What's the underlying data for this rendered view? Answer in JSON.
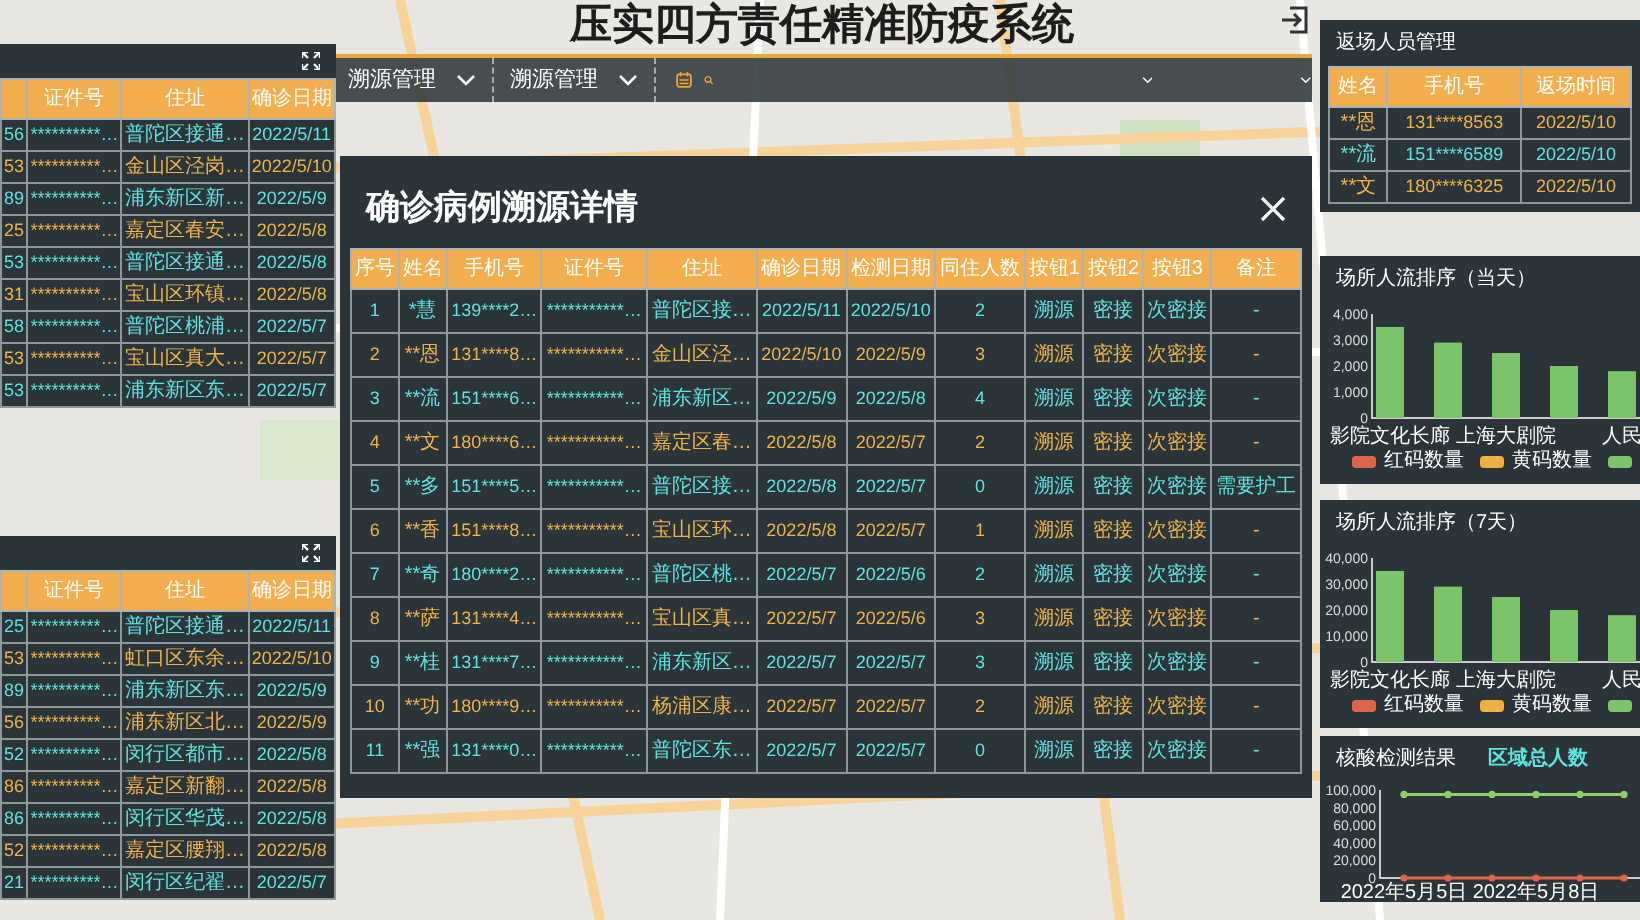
{
  "header": {
    "title": "压实四方责任精准防疫系统",
    "menus": [
      {
        "label": "溯源管理"
      },
      {
        "label": "溯源管理"
      }
    ]
  },
  "left_panels": [
    {
      "columns": [
        "",
        "证件号",
        "住址",
        "确诊日期"
      ],
      "rows": [
        {
          "cells": [
            "56",
            "**********…",
            "普陀区接通…",
            "2022/5/11"
          ],
          "color": "#5fe3e0"
        },
        {
          "cells": [
            "53",
            "**********…",
            "金山区泾岗…",
            "2022/5/10"
          ],
          "color": "#f0b24a"
        },
        {
          "cells": [
            "89",
            "**********…",
            "浦东新区新…",
            "2022/5/9"
          ],
          "color": "#5fe3e0"
        },
        {
          "cells": [
            "25",
            "**********…",
            "嘉定区春安…",
            "2022/5/8"
          ],
          "color": "#f0b24a"
        },
        {
          "cells": [
            "53",
            "**********…",
            "普陀区接通…",
            "2022/5/8"
          ],
          "color": "#5fe3e0"
        },
        {
          "cells": [
            "31",
            "**********…",
            "宝山区环镇…",
            "2022/5/8"
          ],
          "color": "#f0b24a"
        },
        {
          "cells": [
            "58",
            "**********…",
            "普陀区桃浦…",
            "2022/5/7"
          ],
          "color": "#5fe3e0"
        },
        {
          "cells": [
            "53",
            "**********…",
            "宝山区真大…",
            "2022/5/7"
          ],
          "color": "#f0b24a"
        },
        {
          "cells": [
            "53",
            "**********…",
            "浦东新区东…",
            "2022/5/7"
          ],
          "color": "#5fe3e0"
        }
      ]
    },
    {
      "columns": [
        "",
        "证件号",
        "住址",
        "确诊日期"
      ],
      "rows": [
        {
          "cells": [
            "25",
            "**********…",
            "普陀区接通…",
            "2022/5/11"
          ],
          "color": "#5fe3e0"
        },
        {
          "cells": [
            "53",
            "**********…",
            "虹口区东余…",
            "2022/5/10"
          ],
          "color": "#f0b24a"
        },
        {
          "cells": [
            "89",
            "**********…",
            "浦东新区东…",
            "2022/5/9"
          ],
          "color": "#5fe3e0"
        },
        {
          "cells": [
            "56",
            "**********…",
            "浦东新区北…",
            "2022/5/9"
          ],
          "color": "#f0b24a"
        },
        {
          "cells": [
            "52",
            "**********…",
            "闵行区都市…",
            "2022/5/8"
          ],
          "color": "#5fe3e0"
        },
        {
          "cells": [
            "86",
            "**********…",
            "嘉定区新翻…",
            "2022/5/8"
          ],
          "color": "#f0b24a"
        },
        {
          "cells": [
            "86",
            "**********…",
            "闵行区华茂…",
            "2022/5/8"
          ],
          "color": "#5fe3e0"
        },
        {
          "cells": [
            "52",
            "**********…",
            "嘉定区腰翔…",
            "2022/5/8"
          ],
          "color": "#f0b24a"
        },
        {
          "cells": [
            "21",
            "**********…",
            "闵行区纪翟…",
            "2022/5/7"
          ],
          "color": "#5fe3e0"
        }
      ]
    }
  ],
  "modal": {
    "title": "确诊病例溯源详情",
    "columns": [
      "序号",
      "姓名",
      "手机号",
      "证件号",
      "住址",
      "确诊日期",
      "检测日期",
      "同住人数",
      "按钮1",
      "按钮2",
      "按钮3",
      "备注"
    ],
    "rows": [
      {
        "cells": [
          "1",
          "*慧",
          "139****2…",
          "***********…",
          "普陀区接…",
          "2022/5/11",
          "2022/5/10",
          "2",
          "溯源",
          "密接",
          "次密接",
          "-"
        ],
        "color": "#5fe3e0"
      },
      {
        "cells": [
          "2",
          "**恩",
          "131****8…",
          "***********…",
          "金山区泾…",
          "2022/5/10",
          "2022/5/9",
          "3",
          "溯源",
          "密接",
          "次密接",
          "-"
        ],
        "color": "#f0b24a"
      },
      {
        "cells": [
          "3",
          "**流",
          "151****6…",
          "***********…",
          "浦东新区…",
          "2022/5/9",
          "2022/5/8",
          "4",
          "溯源",
          "密接",
          "次密接",
          "-"
        ],
        "color": "#5fe3e0"
      },
      {
        "cells": [
          "4",
          "**文",
          "180****6…",
          "***********…",
          "嘉定区春…",
          "2022/5/8",
          "2022/5/7",
          "2",
          "溯源",
          "密接",
          "次密接",
          "-"
        ],
        "color": "#f0b24a"
      },
      {
        "cells": [
          "5",
          "**多",
          "151****5…",
          "***********…",
          "普陀区接…",
          "2022/5/8",
          "2022/5/7",
          "0",
          "溯源",
          "密接",
          "次密接",
          "需要护工"
        ],
        "color": "#5fe3e0"
      },
      {
        "cells": [
          "6",
          "**香",
          "151****8…",
          "***********…",
          "宝山区环…",
          "2022/5/8",
          "2022/5/7",
          "1",
          "溯源",
          "密接",
          "次密接",
          "-"
        ],
        "color": "#f0b24a"
      },
      {
        "cells": [
          "7",
          "**奇",
          "180****2…",
          "***********…",
          "普陀区桃…",
          "2022/5/7",
          "2022/5/6",
          "2",
          "溯源",
          "密接",
          "次密接",
          "-"
        ],
        "color": "#5fe3e0"
      },
      {
        "cells": [
          "8",
          "**萨",
          "131****4…",
          "***********…",
          "宝山区真…",
          "2022/5/7",
          "2022/5/6",
          "3",
          "溯源",
          "密接",
          "次密接",
          "-"
        ],
        "color": "#f0b24a"
      },
      {
        "cells": [
          "9",
          "**桂",
          "131****7…",
          "***********…",
          "浦东新区…",
          "2022/5/7",
          "2022/5/7",
          "3",
          "溯源",
          "密接",
          "次密接",
          "-"
        ],
        "color": "#5fe3e0"
      },
      {
        "cells": [
          "10",
          "**功",
          "180****9…",
          "***********…",
          "杨浦区康…",
          "2022/5/7",
          "2022/5/7",
          "2",
          "溯源",
          "密接",
          "次密接",
          "-"
        ],
        "color": "#f0b24a"
      },
      {
        "cells": [
          "11",
          "**强",
          "131****0…",
          "***********…",
          "普陀区东…",
          "2022/5/7",
          "2022/5/7",
          "0",
          "溯源",
          "密接",
          "次密接",
          "-"
        ],
        "color": "#5fe3e0"
      }
    ]
  },
  "returnees": {
    "title": "返场人员管理",
    "columns": [
      "姓名",
      "手机号",
      "返场时间"
    ],
    "rows": [
      {
        "cells": [
          "**恩",
          "131****8563",
          "2022/5/10"
        ],
        "color": "#f0b24a"
      },
      {
        "cells": [
          "**流",
          "151****6589",
          "2022/5/10"
        ],
        "color": "#5fe3e0"
      },
      {
        "cells": [
          "**文",
          "180****6325",
          "2022/5/10"
        ],
        "color": "#f0b24a"
      }
    ]
  },
  "charts": [
    {
      "title": "场所人流排序（当天）",
      "chart_data": {
        "type": "bar",
        "categories": [
          "影院文化长廊",
          null,
          "上海大剧院",
          null,
          "人民"
        ],
        "ylim": [
          0,
          4000
        ],
        "yticks": [
          {
            "value": 0,
            "label": "0"
          },
          {
            "value": 1000,
            "label": "1,000"
          },
          {
            "value": 2000,
            "label": "2,000"
          },
          {
            "value": 3000,
            "label": "3,000"
          },
          {
            "value": 4000,
            "label": "4,000"
          }
        ],
        "series": [
          {
            "name": "红码数量",
            "color": "#e0644a",
            "values": [
              null,
              null,
              null,
              null,
              null
            ]
          },
          {
            "name": "黄码数量",
            "color": "#f0b040",
            "values": [
              null,
              null,
              null,
              null,
              null
            ]
          },
          {
            "color": "#7cc46a",
            "values": [
              3500,
              2900,
              2500,
              2000,
              1800
            ]
          }
        ]
      }
    },
    {
      "title": "场所人流排序（7天）",
      "chart_data": {
        "type": "bar",
        "categories": [
          "影院文化长廊",
          null,
          "上海大剧院",
          null,
          "人民"
        ],
        "ylim": [
          0,
          40000
        ],
        "yticks": [
          {
            "value": 0,
            "label": "0"
          },
          {
            "value": 10000,
            "label": "10,000"
          },
          {
            "value": 20000,
            "label": "20,000"
          },
          {
            "value": 30000,
            "label": "30,000"
          },
          {
            "value": 40000,
            "label": "40,000"
          }
        ],
        "series": [
          {
            "name": "红码数量",
            "color": "#e0644a",
            "values": [
              null,
              null,
              null,
              null,
              null
            ]
          },
          {
            "name": "黄码数量",
            "color": "#f0b040",
            "values": [
              null,
              null,
              null,
              null,
              null
            ]
          },
          {
            "color": "#7cc46a",
            "values": [
              35000,
              29000,
              25000,
              20000,
              18000
            ]
          }
        ]
      }
    },
    {
      "title": "核酸检测结果",
      "note": "区域总人数",
      "chart_data": {
        "type": "line",
        "x": [
          "2022年5月5日",
          null,
          null,
          "2022年5月8日",
          null,
          null
        ],
        "ylim": [
          0,
          100000
        ],
        "yticks": [
          {
            "value": 0,
            "label": "0"
          },
          {
            "value": 20000,
            "label": "20,000"
          },
          {
            "value": 40000,
            "label": "40,000"
          },
          {
            "value": 60000,
            "label": "60,000"
          },
          {
            "value": 80000,
            "label": "80,000"
          },
          {
            "value": 100000,
            "label": "100,000"
          }
        ],
        "series": [
          {
            "color": "#8fcf6a",
            "marker": "circle",
            "values": [
              95000,
              95000,
              95000,
              95000,
              95000,
              95000
            ]
          },
          {
            "color": "#e0644a",
            "marker": "circle",
            "values": [
              0,
              0,
              0,
              0,
              0,
              0
            ]
          }
        ]
      }
    }
  ]
}
